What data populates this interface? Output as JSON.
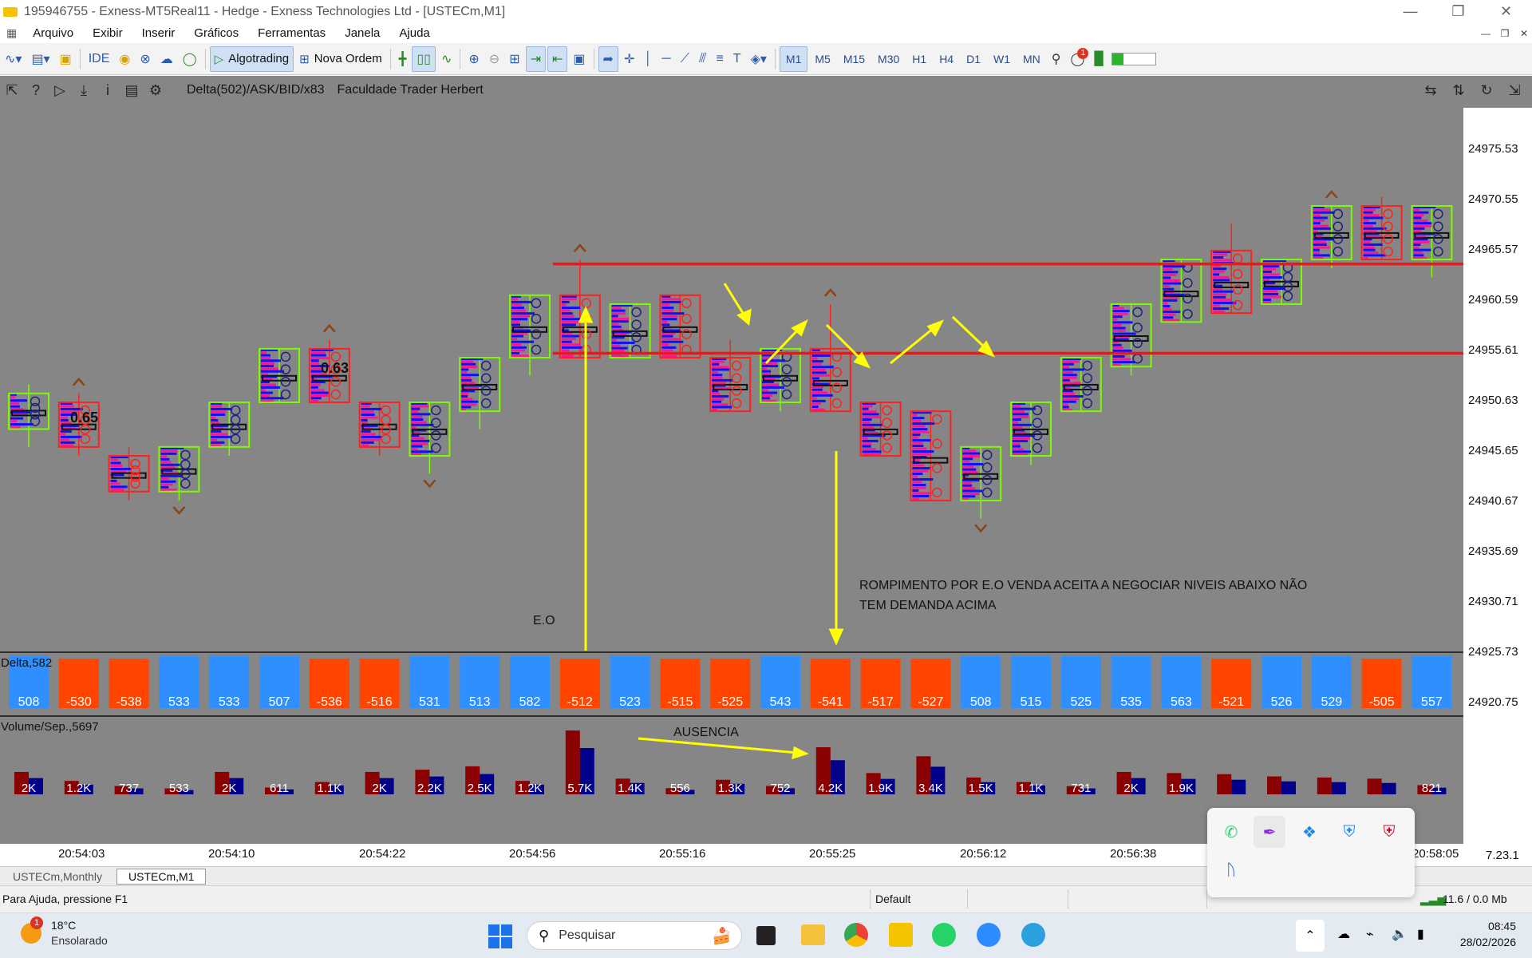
{
  "window": {
    "title": "195946755 - Exness-MT5Real11 - Hedge - Exness Technologies Ltd - [USTECm,M1]"
  },
  "menu": [
    "Arquivo",
    "Exibir",
    "Inserir",
    "Gráficos",
    "Ferramentas",
    "Janela",
    "Ajuda"
  ],
  "toolbar": {
    "ide_label": "IDE",
    "algotrading_label": "Algotrading",
    "nova_ordem_label": "Nova Ordem",
    "timeframes": [
      "M1",
      "M5",
      "M15",
      "M30",
      "H1",
      "H4",
      "D1",
      "W1",
      "MN"
    ],
    "active_timeframe": "M1",
    "notification_count": "1"
  },
  "chart": {
    "indicator_label": "Delta(502)/ASK/BID/x83",
    "author_label": "Faculdade Trader Herbert",
    "colors": {
      "bg": "#868686",
      "bull_box": "#7cfc00",
      "bear_box": "#ff2020",
      "level_line": "#ff1010",
      "arrow": "#ffff00",
      "ask": "#1010ff",
      "bid": "#ff1493"
    },
    "price_labels": [
      "24975.53",
      "24970.55",
      "24965.57",
      "24960.59",
      "24955.61",
      "24950.63",
      "24945.65",
      "24940.67",
      "24935.69",
      "24930.71",
      "24925.73",
      "24920.75"
    ],
    "time_labels": [
      "20:54:03",
      "20:54:10",
      "20:54:22",
      "20:54:56",
      "20:55:16",
      "20:55:25",
      "20:56:12",
      "20:56:38",
      "20:58:05"
    ],
    "annotations": {
      "value_a": "0.65",
      "value_b": "0.63",
      "eo": "E.O",
      "break_line1": "ROMPIMENTO POR E.O VENDA ACEITA A NEGOCIAR NIVEIS ABAIXO NÃO",
      "break_line2": "TEM DEMANDA ACIMA",
      "ausencia": "AUSENCIA"
    },
    "delta_panel_label": "Delta,582",
    "volume_panel_label": "Volume/Sep.,5697",
    "corner_label": "7.23.1"
  },
  "chart_data": [
    {
      "type": "bar",
      "name_label": "Delta,582",
      "values": [
        508,
        -530,
        -538,
        533,
        533,
        507,
        -536,
        -516,
        531,
        513,
        582,
        -512,
        523,
        -515,
        -525,
        543,
        -541,
        -517,
        -527,
        508,
        515,
        525,
        535,
        563,
        -521,
        526,
        529,
        -505,
        557
      ]
    },
    {
      "type": "bar",
      "name_label": "Volume/Sep.,5697",
      "values_text": [
        "2K",
        "1.2K",
        "737",
        "533",
        "2K",
        "611",
        "1.1K",
        "2K",
        "2.2K",
        "2.5K",
        "1.2K",
        "5.7K",
        "1.4K",
        "556",
        "1.3K",
        "752",
        "4.2K",
        "1.9K",
        "3.4K",
        "1.5K",
        "1.1K",
        "731",
        "2K",
        "1.9K",
        "",
        "",
        "",
        "",
        "821"
      ],
      "values": [
        2000,
        1200,
        737,
        533,
        2000,
        611,
        1100,
        2000,
        2200,
        2500,
        1200,
        5700,
        1400,
        556,
        1300,
        752,
        4200,
        1900,
        3400,
        1500,
        1100,
        731,
        2000,
        1900,
        1800,
        1600,
        1500,
        1400,
        821
      ]
    },
    {
      "type": "candlestick",
      "ylim": [
        24918,
        24979
      ],
      "candles": [
        {
          "o": 24943,
          "c": 24947,
          "h": 24948,
          "l": 24941,
          "bull": true
        },
        {
          "o": 24946,
          "c": 24941,
          "h": 24947,
          "l": 24940,
          "bull": false
        },
        {
          "o": 24940,
          "c": 24936,
          "h": 24941,
          "l": 24935,
          "bull": false
        },
        {
          "o": 24936,
          "c": 24941,
          "h": 24941,
          "l": 24935,
          "bull": true
        },
        {
          "o": 24941,
          "c": 24946,
          "h": 24946,
          "l": 24940,
          "bull": true
        },
        {
          "o": 24946,
          "c": 24952,
          "h": 24952,
          "l": 24946,
          "bull": true
        },
        {
          "o": 24952,
          "c": 24946,
          "h": 24953,
          "l": 24946,
          "bull": false
        },
        {
          "o": 24946,
          "c": 24941,
          "h": 24946,
          "l": 24940,
          "bull": false
        },
        {
          "o": 24940,
          "c": 24946,
          "h": 24946,
          "l": 24938,
          "bull": true
        },
        {
          "o": 24945,
          "c": 24951,
          "h": 24951,
          "l": 24943,
          "bull": true
        },
        {
          "o": 24951,
          "c": 24958,
          "h": 24958,
          "l": 24949,
          "bull": true
        },
        {
          "o": 24958,
          "c": 24951,
          "h": 24962,
          "l": 24951,
          "bull": false
        },
        {
          "o": 24951,
          "c": 24957,
          "h": 24957,
          "l": 24951,
          "bull": true
        },
        {
          "o": 24958,
          "c": 24951,
          "h": 24958,
          "l": 24951,
          "bull": false
        },
        {
          "o": 24951,
          "c": 24945,
          "h": 24953,
          "l": 24945,
          "bull": false
        },
        {
          "o": 24946,
          "c": 24952,
          "h": 24952,
          "l": 24945,
          "bull": true
        },
        {
          "o": 24952,
          "c": 24945,
          "h": 24957,
          "l": 24945,
          "bull": false
        },
        {
          "o": 24946,
          "c": 24940,
          "h": 24946,
          "l": 24940,
          "bull": false
        },
        {
          "o": 24945,
          "c": 24935,
          "h": 24945,
          "l": 24935,
          "bull": false
        },
        {
          "o": 24935,
          "c": 24941,
          "h": 24941,
          "l": 24933,
          "bull": true
        },
        {
          "o": 24940,
          "c": 24946,
          "h": 24946,
          "l": 24939,
          "bull": true
        },
        {
          "o": 24945,
          "c": 24951,
          "h": 24951,
          "l": 24945,
          "bull": true
        },
        {
          "o": 24950,
          "c": 24957,
          "h": 24957,
          "l": 24949,
          "bull": true
        },
        {
          "o": 24955,
          "c": 24962,
          "h": 24962,
          "l": 24955,
          "bull": true
        },
        {
          "o": 24963,
          "c": 24956,
          "h": 24966,
          "l": 24956,
          "bull": false
        },
        {
          "o": 24957,
          "c": 24962,
          "h": 24962,
          "l": 24957,
          "bull": true
        },
        {
          "o": 24962,
          "c": 24968,
          "h": 24968,
          "l": 24961,
          "bull": true
        },
        {
          "o": 24968,
          "c": 24962,
          "h": 24969,
          "l": 24962,
          "bull": false
        },
        {
          "o": 24962,
          "c": 24968,
          "h": 24968,
          "l": 24960,
          "bull": true
        }
      ],
      "levels": [
        24961.5,
        24951.5
      ]
    }
  ],
  "tabs": [
    "USTECm,Monthly",
    "USTECm,M1"
  ],
  "status": {
    "help": "Para Ajuda, pressione F1",
    "profile": "Default",
    "traffic": "11.6 / 0.0 Mb"
  },
  "taskbar": {
    "weather_temp": "18°C",
    "weather_desc": "Ensolarado",
    "weather_badge": "1",
    "search_placeholder": "Pesquisar",
    "time": "08:45",
    "date": "28/02/2026"
  }
}
